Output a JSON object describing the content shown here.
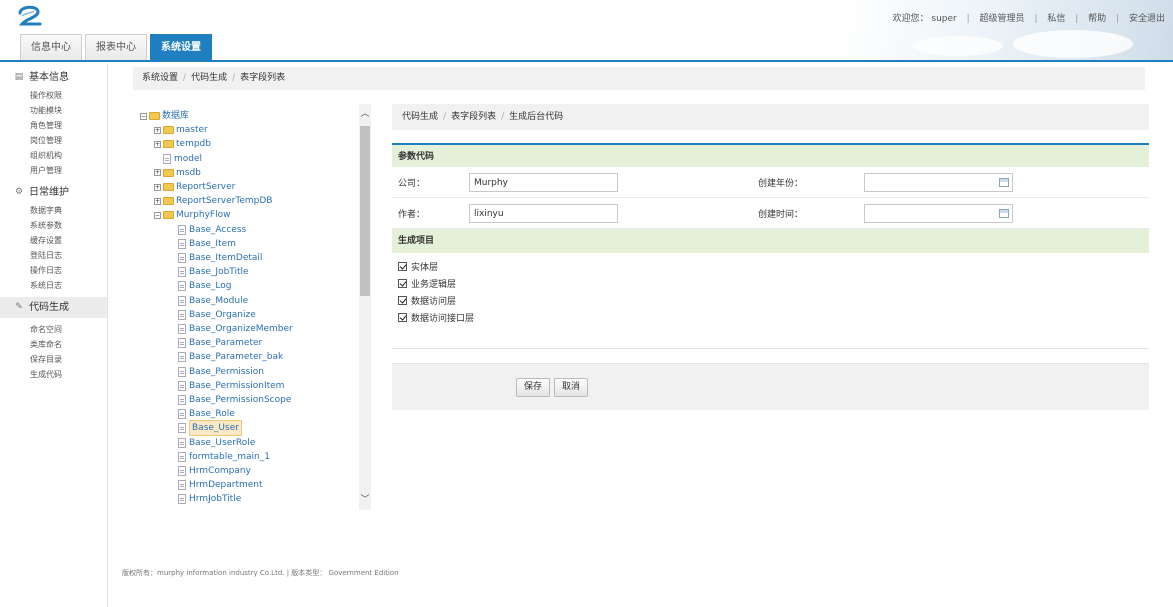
{
  "header": {
    "welcome": "欢迎您：",
    "user": "super",
    "links": [
      "超级管理员",
      "私信",
      "帮助",
      "安全退出"
    ]
  },
  "tabs": [
    "信息中心",
    "报表中心",
    "系统设置"
  ],
  "sidebar": {
    "sections": [
      {
        "title": "基本信息",
        "items": [
          "操作权限",
          "功能模块",
          "角色管理",
          "岗位管理",
          "组织机构",
          "用户管理"
        ]
      },
      {
        "title": "日常维护",
        "items": [
          "数据字典",
          "系统参数",
          "缓存设置",
          "登陆日志",
          "操作日志",
          "系统日志"
        ]
      },
      {
        "title": "代码生成",
        "items": [
          "命名空间",
          "类库命名",
          "保存目录",
          "生成代码"
        ]
      }
    ]
  },
  "breadcrumb": [
    "系统设置",
    "代码生成",
    "表字段列表"
  ],
  "tree": {
    "root": "数据库",
    "databases": [
      "master",
      "tempdb",
      "model",
      "msdb",
      "ReportServer",
      "ReportServerTempDB",
      "MurphyFlow"
    ],
    "tables": [
      "Base_Access",
      "Base_Item",
      "Base_ItemDetail",
      "Base_JobTitle",
      "Base_Log",
      "Base_Module",
      "Base_Organize",
      "Base_OrganizeMember",
      "Base_Parameter",
      "Base_Parameter_bak",
      "Base_Permission",
      "Base_PermissionItem",
      "Base_PermissionScope",
      "Base_Role",
      "Base_User",
      "Base_UserRole",
      "formtable_main_1",
      "HrmCompany",
      "HrmDepartment",
      "HrmJobTitle"
    ],
    "selected": "Base_User"
  },
  "panel": {
    "breadcrumb": [
      "代码生成",
      "表字段列表",
      "生成后台代码"
    ],
    "params_title": "参数代码",
    "company_label": "公司：",
    "company_value": "Murphy",
    "year_label": "创建年份：",
    "author_label": "作者：",
    "author_value": "lixinyu",
    "time_label": "创建时间：",
    "items_title": "生成项目",
    "options": [
      "实体层",
      "业务逻辑层",
      "数据访问层",
      "数据访问接口层"
    ],
    "save_label": "保存",
    "cancel_label": "取消"
  },
  "footer": "版权所有：murphy information industry Co.Ltd. | 版本类型： Government Edition",
  "colors": {
    "accent": "#1f7fc0",
    "section_band": "#e5f0d9",
    "selected_node": "#fbe9c5"
  }
}
